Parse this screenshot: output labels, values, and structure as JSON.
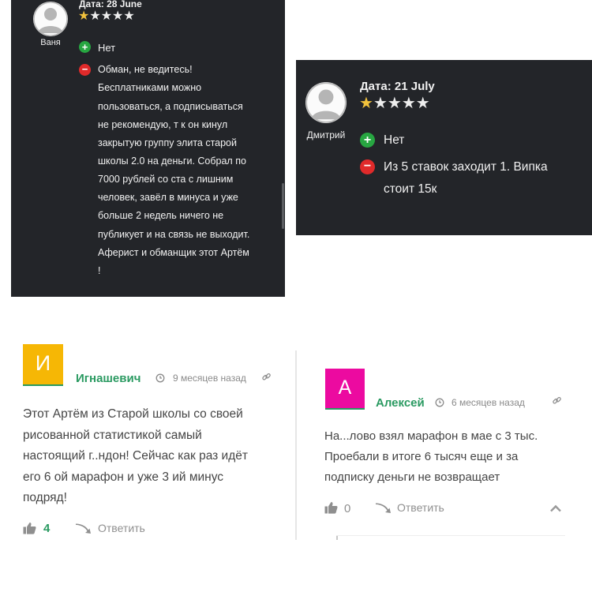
{
  "review1": {
    "user_name": "Ваня",
    "date": "Дата: 28 June",
    "stars_filled": 1,
    "stars_total": 5,
    "pros": "Нет",
    "cons_lines": [
      "Обман, не ведитесь!",
      "Бесплатниками можно",
      "пользоваться, а подписываться",
      "не рекомендую, т к он кинул",
      "закрытую группу элита старой",
      "школы 2.0 на деньги. Собрал по",
      "7000 рублей со ста с лишним",
      "человек, завёл в минуса и уже",
      "больше 2 недель ничего не",
      "публикует и на связь не выходит.",
      "Аферист и обманщик этот Артём",
      "!"
    ]
  },
  "review2": {
    "user_name": "Дмитрий",
    "date": "Дата: 21 July",
    "stars_filled": 1,
    "stars_total": 5,
    "pros": "Нет",
    "cons_lines": [
      "Из 5 ставок заходит 1. Випка",
      "стоит 15к"
    ]
  },
  "comment1": {
    "avatar_letter": "И",
    "avatar_color": "#f6b705",
    "author": "Игнашевич",
    "time": "9 месяцев назад",
    "text_lines": [
      "Этот Артём из Старой школы со своей",
      "рисованной статистикой самый",
      "настоящий г..ндон! Сейчас как раз идёт",
      "его 6 ой марафон и уже 3 ий минус",
      "подряд!"
    ],
    "likes": "4",
    "reply_label": "Ответить"
  },
  "comment2": {
    "avatar_letter": "А",
    "avatar_color": "#ec0aa0",
    "author": "Алексей",
    "time": "6 месяцев назад",
    "text_lines": [
      "На...лово взял марафон в мае с 3 тыс.",
      "Проебали в итоге 6 тысяч еще и за",
      "подписку деньги не возвращает"
    ],
    "likes": "0",
    "reply_label": "Ответить"
  },
  "icons": {
    "avatar": "user-silhouette-icon",
    "star": "star-icon",
    "plus": "plus-circle-icon",
    "minus": "minus-circle-icon",
    "clock": "clock-icon",
    "link": "link-icon",
    "like": "thumbs-up-icon",
    "reply": "reply-arrow-icon",
    "collapse": "chevron-up-icon"
  },
  "colors": {
    "dark_panel": "#232529",
    "star_on": "#f2c23c",
    "plus": "#27a641",
    "minus": "#e02a2a",
    "author_green": "#2a9a61"
  }
}
